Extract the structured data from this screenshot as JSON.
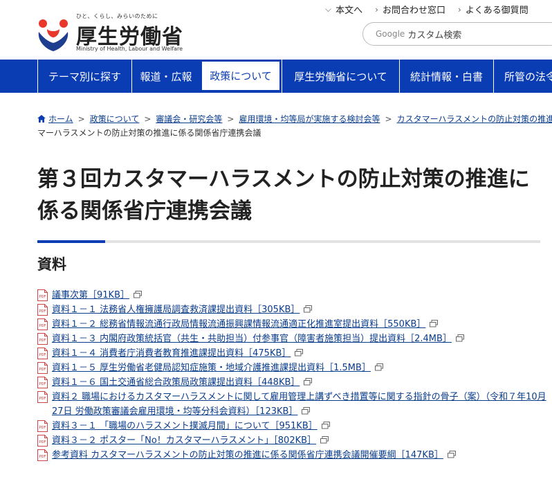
{
  "header": {
    "tagline": "ひと、くらし、みらいのために",
    "org_name": "厚生労働省",
    "org_name_en": "Ministry of Health, Labour and Welfare",
    "util_links": [
      {
        "label": "本文へ"
      },
      {
        "label": "お問合わせ窓口"
      },
      {
        "label": "よくある御質問"
      }
    ],
    "search": {
      "brand": "Google",
      "placeholder": "カスタム検索"
    }
  },
  "nav": {
    "items": [
      {
        "label": "テーマ別に探す"
      },
      {
        "label": "報道・広報"
      },
      {
        "label": "政策について"
      },
      {
        "label": "厚生労働省について"
      },
      {
        "label": "統計情報・白書"
      },
      {
        "label": "所管の法令"
      }
    ]
  },
  "breadcrumb": {
    "items": [
      {
        "label": "ホーム"
      },
      {
        "label": "政策について"
      },
      {
        "label": "審議会・研究会等"
      },
      {
        "label": "雇用環境・均等局が実施する検討会等"
      },
      {
        "label": "カスタマーハラスメントの防止対策の推進に"
      }
    ],
    "current": "マーハラスメントの防止対策の推進に係る関係省庁連携会議"
  },
  "page": {
    "title": "第３回カスタマーハラスメントの防止対策の推進に係る関係省庁連携会議",
    "section_heading": "資料"
  },
  "documents": [
    {
      "label": "議事次第［91KB］"
    },
    {
      "label": "資料１－１ 法務省人権擁護局調査救済課提出資料［305KB］"
    },
    {
      "label": "資料１－２ 総務省情報流通行政局情報流通振興課情報流通適正化推進室提出資料［550KB］"
    },
    {
      "label": "資料１－３ 内閣府政策統括官（共生・共助担当）付参事官（障害者施策担当）提出資料［2.4MB］"
    },
    {
      "label": "資料１－４ 消費者庁消費者教育推進課提出資料［475KB］"
    },
    {
      "label": "資料１－５ 厚生労働省老健局認知症施策・地域介護推進課提出資料［1.5MB］"
    },
    {
      "label": "資料１－６ 国土交通省総合政策局政策課提出資料［448KB］"
    },
    {
      "label": "資料２ 職場におけるカスタマーハラスメントに関して雇用管理上講ずべき措置等に関する指針の骨子（案）（令和７年10月27日 労働政策審議会雇用環境・均等分科会資料）［123KB］"
    },
    {
      "label": "資料３－１ 「職場のハラスメント撲滅月間」について［951KB］"
    },
    {
      "label": "資料３－２ ポスター「No！カスタマーハラスメント」［802KB］"
    },
    {
      "label": "参考資料 カスタマーハラスメントの防止対策の推進に係る関係省庁連携会議開催要綱［147KB］"
    }
  ],
  "icons": {
    "pdf": "pdf-icon",
    "external": "external-window-icon",
    "home": "home-icon",
    "chevron": "chevron-right-icon"
  },
  "colors": {
    "primary": "#0a3cb4",
    "link": "#0a3c8c",
    "logo_red": "#e8382b",
    "logo_blue": "#1d3d8f"
  }
}
